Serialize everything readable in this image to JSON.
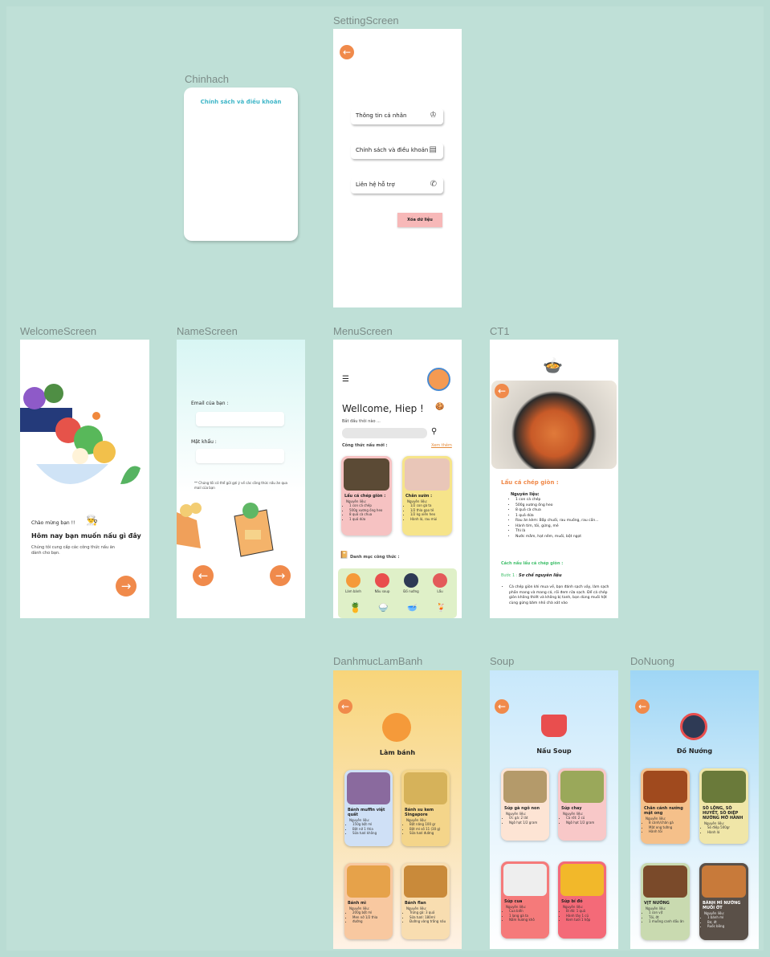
{
  "frames": {
    "setting": "SettingScreen",
    "chinhach": "Chinhach",
    "welcome": "WelcomeScreen",
    "name": "NameScreen",
    "menu": "MenuScreen",
    "ct1": "CT1",
    "lambanh": "DanhmucLamBanh",
    "soup": "Soup",
    "donuong": "DoNuong"
  },
  "chinhach": {
    "title": "Chính sách và điều khoản"
  },
  "setting": {
    "row1": "Thông tin cá nhân",
    "row2": "Chính sách và điều khoản",
    "row3": "Liên hệ hỗ trợ",
    "delete": "Xóa dữ liệu"
  },
  "welcome": {
    "greet": "Chào mừng bạn !!",
    "title": "Hôm nay bạn muốn nấu gì đây",
    "desc": "Chúng tôi cung cấp các công thức nấu ăn dành cho bạn."
  },
  "name": {
    "email_label": "Email của bạn :",
    "pass_label": "Mật khẩu :",
    "note": "** Chúng tôi có thể gửi gợi ý về các công thức nấu ăn qua mail của bạn"
  },
  "menu": {
    "welcome": "Wellcome, Hiep !",
    "search_hint": "Bắt đầu thôi nào ...",
    "section1": "Công thức nấu mới :",
    "more": "Xem thêm",
    "card1": {
      "title": "Lẩu cá chép giòn :",
      "sub": "Nguyên liệu:",
      "items": [
        "1 con cá chép",
        "500g xương ống heo",
        "8 quả cà chua",
        "1 quả dứa"
      ]
    },
    "card2": {
      "title": "Chân sườn :",
      "sub": "Nguyên liệu:",
      "items": [
        "1/2 con gà ta",
        "1/2 thìa gạo tẻ",
        "1/2 kg xiên heo",
        "Hành lá, rau mùi"
      ]
    },
    "section2": "Danh mục công thức :",
    "cats": [
      "Làm bánh",
      "Nấu soup",
      "Đồ nướng",
      "Lẩu"
    ]
  },
  "ct1": {
    "title": "Lẩu cá chép giòn :",
    "ing_label": "Nguyên liệu:",
    "ingredients": [
      "1 con cá chép",
      "500g xương ống heo",
      "8 quả cà chua",
      "1 quả dứa",
      "Rau ăn kèm: Bắp chuối, rau muống, rau cần...",
      "Hành tím, tỏi, gừng, mẻ",
      "Thì là",
      "Nước mắm, hạt nêm, muối, bột ngọt"
    ],
    "how": "Cách nấu lẩu cá chép giòn :",
    "step_label": "Bước 1 :",
    "step_text": "Sơ chế nguyên liệu",
    "step_detail": "Cá chép giòn khi mua về, bạn đánh sạch vảy, làm sạch phần mang và mang cá, rồi đem rửa sạch. Để cá chép giòn không thiết và không bị tanh, bạn dùng muối hột cùng gừng băm nhỏ chà xát vào"
  },
  "lambanh": {
    "title": "Làm bánh",
    "c1": {
      "title": "Bánh muffin việt quất",
      "sub": "Nguyên liệu:",
      "items": [
        "150g bột mì",
        "Bột nở 1 thìa",
        "Sữa tươi không"
      ]
    },
    "c2": {
      "title": "Bánh su kem Singapore",
      "sub": "Nguyên liệu:",
      "items": [
        "Bột năng 100 gr",
        "Bột mì số 11 (30 g)",
        "Sữa tươi đường"
      ]
    },
    "c3": {
      "title": "Bánh mì",
      "sub": "Nguyên liệu:",
      "items": [
        "200g bột mì",
        "Men nở 1/2 thìa",
        "đường"
      ]
    },
    "c4": {
      "title": "Bánh flan",
      "sub": "Nguyên liệu:",
      "items": [
        "Trứng gà: 3 quả",
        "Sữa tươi: 180ml",
        "Đường vàng trắng nâu"
      ]
    }
  },
  "soup": {
    "title": "Nấu Soup",
    "c1": {
      "title": "Súp gà ngô non",
      "sub": "Nguyên liệu:",
      "items": [
        "Ức gà: 2 lát",
        "Ngô hạt 1/2 gram"
      ]
    },
    "c2": {
      "title": "Súp chay",
      "sub": "Nguyên liệu:",
      "items": [
        "Cà rốt: 2 củ",
        "Ngô hạt 1/2 gram"
      ]
    },
    "c3": {
      "title": "Súp cua",
      "sub": "Nguyên liệu:",
      "items": [
        "Cua biển",
        "1 lạng gà ta",
        "Nấm hương khô"
      ]
    },
    "c4": {
      "title": "Súp bí đỏ",
      "sub": "Nguyên liệu:",
      "items": [
        "Bí đỏ: 1 quả",
        "Hành tây 1 củ",
        "Kem tươi 1 hộp"
      ]
    }
  },
  "donuong": {
    "title": "Đồ Nướng",
    "c1": {
      "title": "Chân cánh nướng mật ong",
      "sub": "Nguyên liệu:",
      "items": [
        "8 cánh/chân gà",
        "Mật ong tường",
        "Hành tỏi"
      ]
    },
    "c2": {
      "title": "SÒ LÔNG, SÒ HUYẾT, SÒ ĐIỆP NƯỚNG MỠ HÀNH",
      "sub": "Nguyên liệu:",
      "items": [
        "Sò điệp 500gr",
        "Hành lá"
      ]
    },
    "c3": {
      "title": "VỊT NƯỚNG",
      "sub": "Nguyên liệu:",
      "items": [
        "1 con vịt",
        "Tỏi, ớt",
        "1 muỗng canh dầu ăn"
      ]
    },
    "c4": {
      "title": "BÁNH MÌ NƯỚNG MUỐI ỚT",
      "sub": "Nguyên liệu:",
      "items": [
        "1 bánh mì",
        "Bơ, ớt",
        "Ruốc bông"
      ]
    }
  }
}
